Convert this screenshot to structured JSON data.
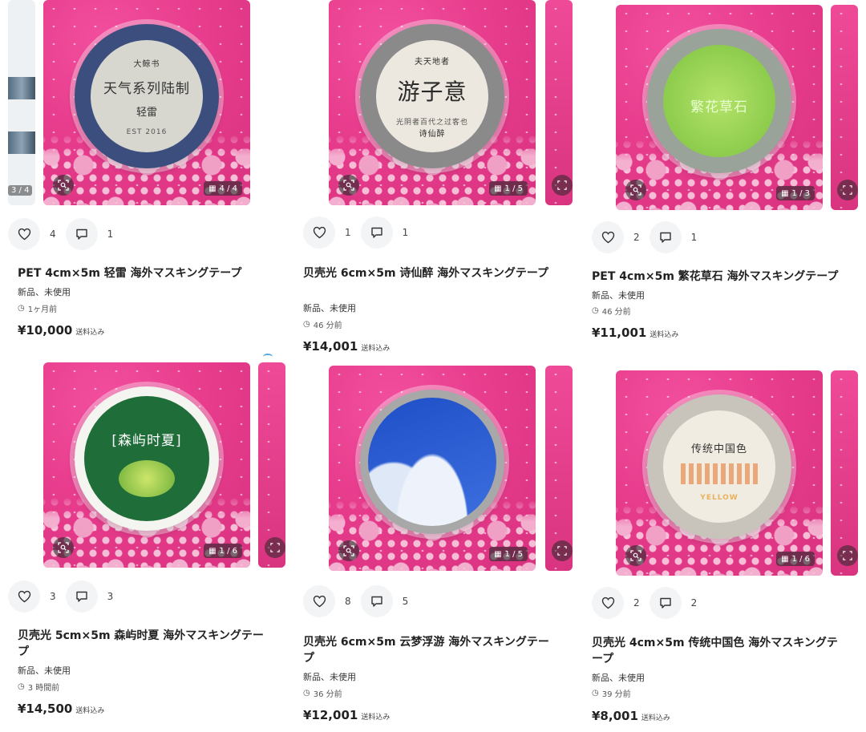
{
  "listings": [
    {
      "title": "PET 4cm×5m 轻雷 海外マスキングテープ",
      "condition": "新品、未使用",
      "posted": "1ヶ月前",
      "price": "¥10,000",
      "shipping": "送料込み",
      "likes": "4",
      "comments": "1",
      "image_counter": "4 / 4",
      "prev_counter": "3 / 4",
      "tape_text": {
        "brand": "大鲸书",
        "line1": "天气系列陆制",
        "line2": "轻雷",
        "line3": "EST 2016"
      },
      "colors": {
        "tape_outer": "#3b4e7e",
        "tape_inner": "#d7d7d0",
        "text": "#333333"
      }
    },
    {
      "title": "贝壳光 6cm×5m 诗仙醉 海外マスキングテープ",
      "condition": "新品、未使用",
      "posted": "46 分前",
      "price": "¥14,001",
      "shipping": "送料込み",
      "likes": "1",
      "comments": "1",
      "image_counter": "1 / 5",
      "tape_text": {
        "brand": "诗仙醉",
        "line1": "游子意",
        "line2": "光阴者百代之过客也",
        "line3": "夫天地者"
      },
      "colors": {
        "tape_outer": "#8a8a8a",
        "tape_inner": "#ece8df",
        "text": "#2a2a2a"
      }
    },
    {
      "title": "PET 4cm×5m 繁花草石 海外マスキングテープ",
      "condition": "新品、未使用",
      "posted": "46 分前",
      "price": "¥11,001",
      "shipping": "送料込み",
      "likes": "2",
      "comments": "1",
      "image_counter": "1 / 3",
      "tape_text": {
        "brand": "",
        "line1": "繁花草石",
        "line2": "",
        "line3": ""
      },
      "colors": {
        "tape_outer": "#9aa39a",
        "tape_inner": "#8fd14f",
        "text": "#e8ffd0"
      }
    },
    {
      "title": "贝壳光 5cm×5m 森屿时夏 海外マスキングテープ",
      "condition": "新品、未使用",
      "posted": "3 時間前",
      "price": "¥14,500",
      "shipping": "送料込み",
      "likes": "3",
      "comments": "3",
      "image_counter": "1 / 6",
      "tape_text": {
        "brand": "",
        "line1": "[森屿时夏]",
        "line2": "",
        "line3": ""
      },
      "colors": {
        "tape_outer": "#f4f4f0",
        "tape_inner": "#1f6e3a",
        "text": "#ffffff"
      }
    },
    {
      "title": "贝壳光 6cm×5m 云梦浮游 海外マスキングテープ",
      "condition": "新品、未使用",
      "posted": "36 分前",
      "price": "¥12,001",
      "shipping": "送料込み",
      "likes": "8",
      "comments": "5",
      "image_counter": "1 / 5",
      "tape_text": {
        "brand": "",
        "line1": "",
        "line2": "",
        "line3": ""
      },
      "colors": {
        "tape_outer": "#a8a8a8",
        "tape_inner": "#2d5fd1",
        "text": "#ffffff"
      }
    },
    {
      "title": "贝壳光 4cm×5m 传统中国色 海外マスキングテープ",
      "condition": "新品、未使用",
      "posted": "39 分前",
      "price": "¥8,001",
      "shipping": "送料込み",
      "likes": "2",
      "comments": "2",
      "image_counter": "1 / 6",
      "tape_text": {
        "brand": "",
        "line1": "传统中国色",
        "line2": "YELLOW",
        "line3": ""
      },
      "colors": {
        "tape_outer": "#c9c4bb",
        "tape_inner": "#f1ece2",
        "text": "#e07a3a"
      }
    }
  ],
  "icons": {
    "like": "heart-icon",
    "comment": "comment-icon",
    "lens": "lens-search-icon",
    "gallery": "grid-icon",
    "clock": "clock-icon"
  }
}
